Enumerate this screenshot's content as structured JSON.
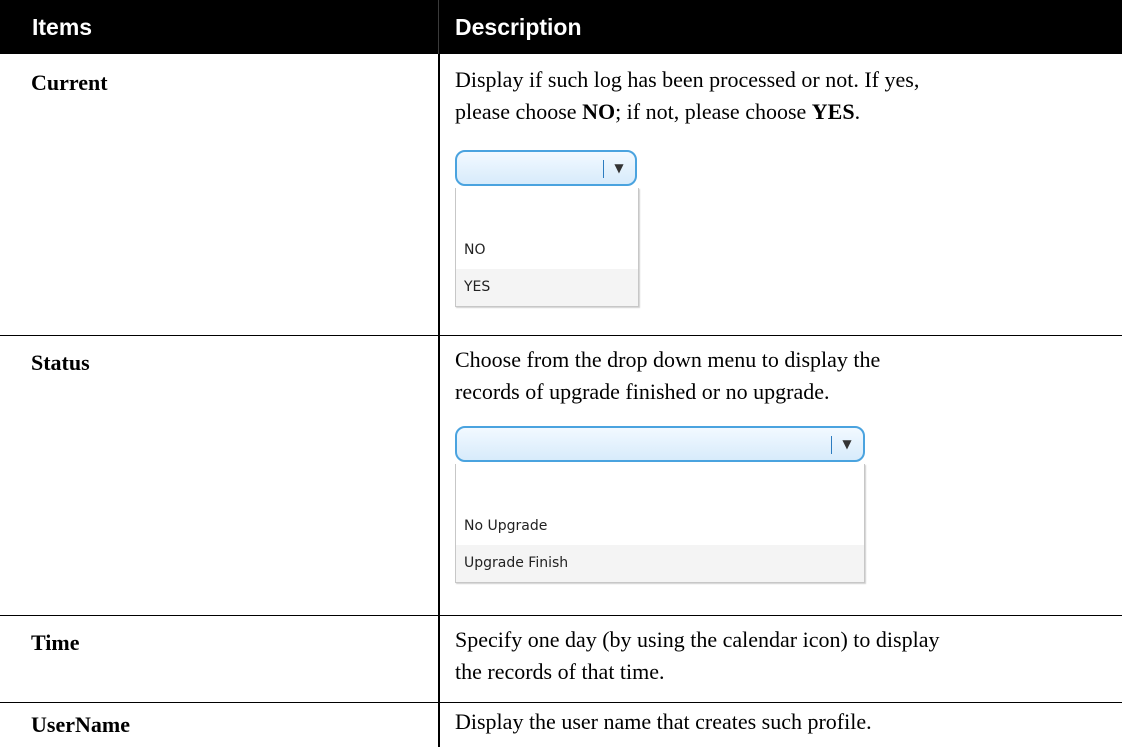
{
  "header": {
    "items": "Items",
    "description": "Description"
  },
  "rows": [
    {
      "item": "Current",
      "desc_line1": "Display if such log has been processed or not. If yes,",
      "desc_pre": "please choose ",
      "desc_b1": "NO",
      "desc_mid": "; if not, please choose ",
      "desc_b2": "YES",
      "desc_post": ".",
      "dropdown": {
        "selected": "",
        "options": [
          "",
          "NO",
          "YES"
        ]
      }
    },
    {
      "item": "Status",
      "desc_line1": "Choose from the drop down menu to display the",
      "desc_line2": "records of upgrade finished or no upgrade.",
      "dropdown": {
        "selected": "",
        "options": [
          "",
          "No Upgrade",
          "Upgrade Finish"
        ]
      }
    },
    {
      "item": "Time",
      "desc_line1": "Specify one day (by using the calendar icon) to display",
      "desc_line2": "the records of that time."
    },
    {
      "item": "UserName",
      "desc_line1": "Display the user name that creates such profile."
    }
  ],
  "icons": {
    "dropdown_arrow": "chevron-down-icon"
  }
}
